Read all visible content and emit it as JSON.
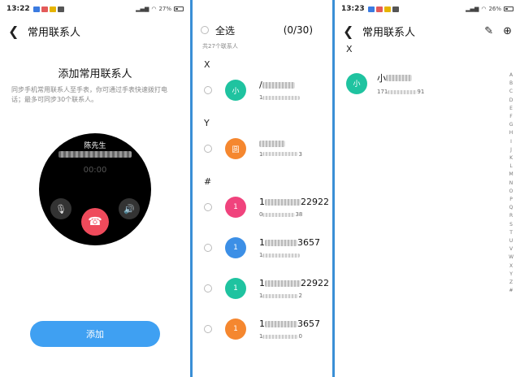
{
  "screen1": {
    "status": {
      "time": "13:22",
      "battery": "27%"
    },
    "title": "常用联系人",
    "heading": "添加常用联系人",
    "description": "同步手机常用联系人至手表，你可通过手表快速拨打电话；最多可同步30个联系人。",
    "watch": {
      "caller": "陈先生",
      "timer": "00:00"
    },
    "add_button": "添加"
  },
  "screen2": {
    "select_all": "全选",
    "count": "(0/30)",
    "total": "共27个联系人",
    "groups": [
      {
        "letter": "X",
        "contacts": [
          {
            "avatar": "小",
            "color": "#1fc3a0",
            "name_prefix": "/",
            "name_suffix": "",
            "num_prefix": "1",
            "num_suffix": ""
          }
        ]
      },
      {
        "letter": "Y",
        "contacts": [
          {
            "avatar": "圆",
            "color": "#f5872f",
            "name_prefix": "圆",
            "name_suffix": "",
            "num_prefix": "1",
            "num_suffix": "3"
          }
        ]
      },
      {
        "letter": "#",
        "contacts": [
          {
            "avatar": "1",
            "color": "#f0437d",
            "name_prefix": "1",
            "name_suffix": "22922",
            "num_prefix": "0",
            "num_suffix": "38"
          },
          {
            "avatar": "1",
            "color": "#3c8fe6",
            "name_prefix": "1",
            "name_suffix": "3657",
            "num_prefix": "1",
            "num_suffix": ""
          },
          {
            "avatar": "1",
            "color": "#1fc3a0",
            "name_prefix": "1",
            "name_suffix": "22922",
            "num_prefix": "1",
            "num_suffix": "2"
          },
          {
            "avatar": "1",
            "color": "#f5872f",
            "name_prefix": "1",
            "name_suffix": "3657",
            "num_prefix": "1",
            "num_suffix": "0"
          }
        ]
      }
    ]
  },
  "screen3": {
    "status": {
      "time": "13:23",
      "battery": "26%"
    },
    "title": "常用联系人",
    "edit_icon": "pencil-icon",
    "add_icon": "plus-circle-icon",
    "section": "X",
    "contact": {
      "avatar": "小",
      "color": "#1fc3a0",
      "name_prefix": "小",
      "num_prefix": "171",
      "num_suffix": "91"
    },
    "alphabet": [
      "A",
      "B",
      "C",
      "D",
      "E",
      "F",
      "G",
      "H",
      "I",
      "J",
      "K",
      "L",
      "M",
      "N",
      "O",
      "P",
      "Q",
      "R",
      "S",
      "T",
      "U",
      "V",
      "W",
      "X",
      "Y",
      "Z",
      "#"
    ]
  }
}
